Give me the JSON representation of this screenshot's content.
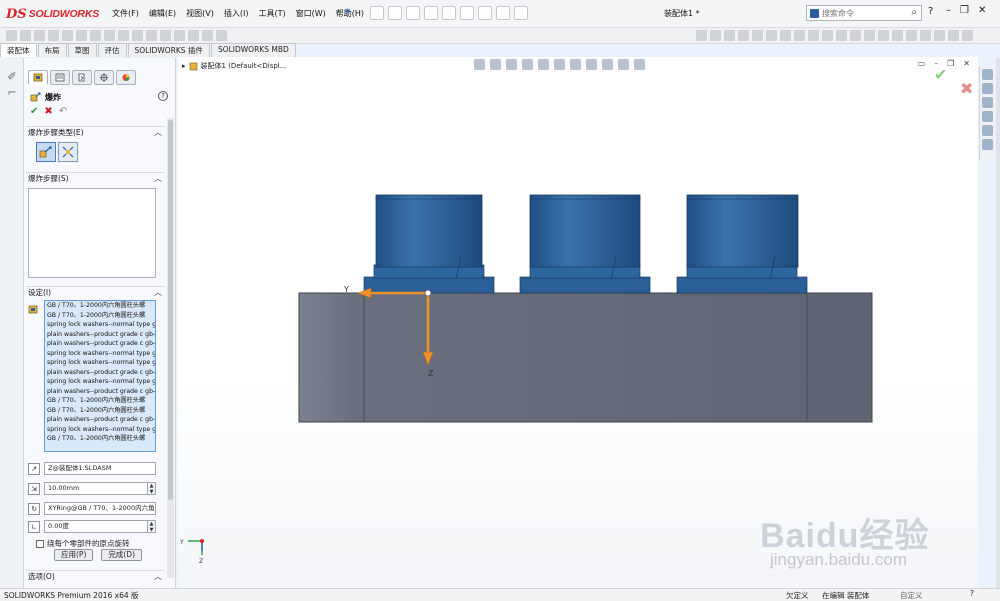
{
  "app": {
    "logo_mark": "DS",
    "logo_text": "SOLIDWORKS",
    "doc_title": "装配体1 *"
  },
  "menu": [
    "文件(F)",
    "编辑(E)",
    "视图(V)",
    "插入(I)",
    "工具(T)",
    "窗口(W)",
    "帮助(H)"
  ],
  "search": {
    "placeholder": "搜索命令"
  },
  "help": "?",
  "tabs": [
    "装配体",
    "布局",
    "草图",
    "评估",
    "SOLIDWORKS 插件",
    "SOLIDWORKS MBD"
  ],
  "property_manager": {
    "title": "爆炸",
    "help": "?",
    "ok": "✔",
    "cancel": "✖",
    "undo": "↶",
    "group_step_type": "爆炸步骤类型(E)",
    "group_steps": "爆炸步骤(S)",
    "group_settings": "设定(I)",
    "settings_items": [
      "GB / T70、1-2000内六角圆柱头螺",
      "GB / T70、1-2000内六角圆柱头螺",
      "spring lock washers--normal type g",
      "plain washers--product grade c gb-",
      "plain washers--product grade c gb-",
      "spring lock washers--normal type g",
      "spring lock washers--normal type g",
      "plain washers--product grade c gb-",
      "spring lock washers--normal type g",
      "plain washers--product grade c gb-",
      "GB / T70、1-2000内六角圆柱头螺",
      "GB / T70、1-2000内六角圆柱头螺",
      "plain washers--product grade c gb-",
      "spring lock washers--normal type g",
      "GB / T70、1-2000内六角圆柱头螺"
    ],
    "direction": "Z@装配体1.SLDASM",
    "distance": "10.00mm",
    "rotation_axis": "XYRing@GB / T70、1-2000内六角圆",
    "angle": "0.00度",
    "rotate_about_origin": "绕每个零部件的原点旋转",
    "apply_button": "应用(P)",
    "done_button": "完成(D)",
    "group_options": "选项(O)"
  },
  "viewport": {
    "tree_item": "装配体1  (Default<Displ...",
    "axis_y": "Y",
    "axis_z": "Z",
    "triad_y": "Y",
    "triad_z": "Z"
  },
  "status": {
    "product": "SOLIDWORKS Premium 2016 x64 版",
    "under_defined": "欠定义",
    "editing": "在编辑 装配体",
    "custom": "自定义"
  },
  "watermark": {
    "main": "Baidu经验",
    "sub": "jingyan.baidu.com"
  },
  "colors": {
    "accent": "#2b5d9e",
    "cap_blue": "#2a5f97",
    "base_grey": "#6b7080",
    "arrow_orange": "#f0902a"
  }
}
